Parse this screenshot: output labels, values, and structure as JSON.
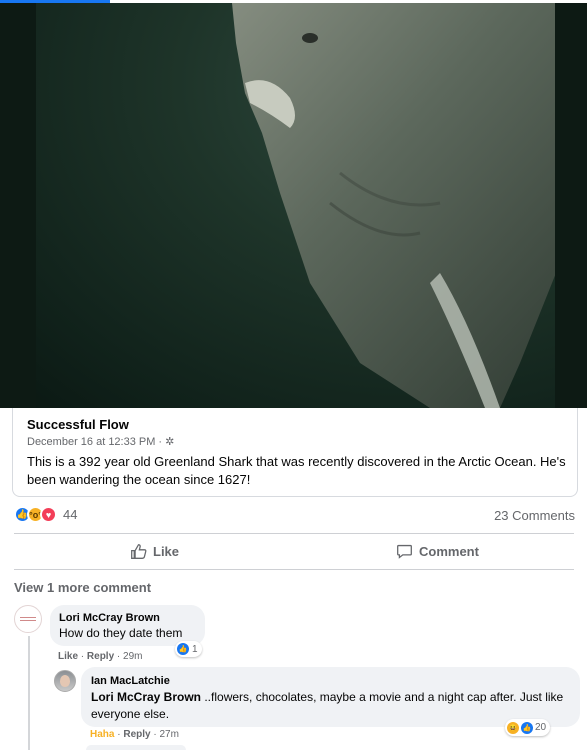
{
  "post": {
    "author": "Successful Flow",
    "timestamp": "December 16 at 12:33 PM",
    "separator": "·",
    "text": "This is a 392 year old Greenland Shark that was recently discovered in the Arctic Ocean. He's been wandering the ocean since 1627!"
  },
  "reactions": {
    "count": "44",
    "types": [
      "like-icon",
      "wow-icon",
      "love-icon"
    ],
    "comments_count": "23 Comments"
  },
  "actions": {
    "like_label": "Like",
    "comment_label": "Comment"
  },
  "view_more": "View 1 more comment",
  "comments": [
    {
      "name": "Lori McCray Brown",
      "text": "How do they date them",
      "like_link": "Like",
      "reply_link": "Reply",
      "time": "29m",
      "reaction_count": "1"
    },
    {
      "name": "Ian MacLatchie",
      "mention": "Lori McCray Brown",
      "text": " ..flowers, chocolates, maybe a movie and a night cap after. Just like everyone else.",
      "reaction_link": "Haha",
      "reply_link": "Reply",
      "time": "27m",
      "reaction_count": "20"
    }
  ],
  "colors": {
    "accent": "#1877f2",
    "secondary_text": "#65676b",
    "bubble": "#f0f2f5",
    "love": "#f33e58",
    "haha": "#f7b125"
  }
}
